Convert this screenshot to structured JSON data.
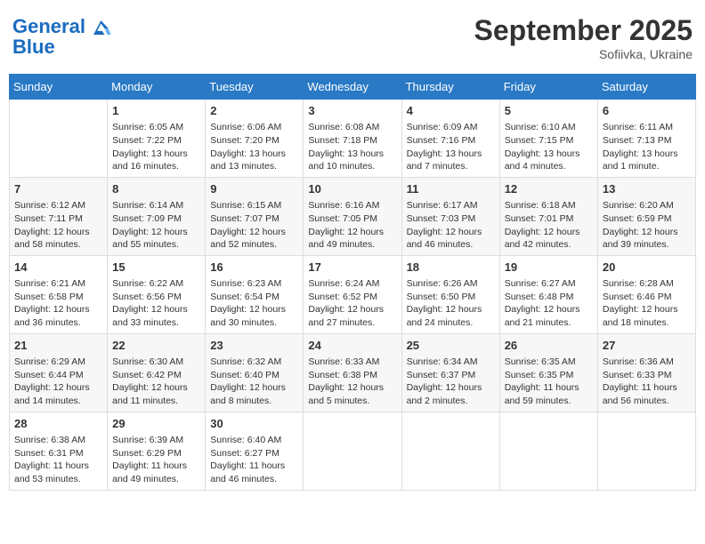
{
  "header": {
    "logo_line1": "General",
    "logo_line2": "Blue",
    "month_title": "September 2025",
    "location": "Sofiivka, Ukraine"
  },
  "weekdays": [
    "Sunday",
    "Monday",
    "Tuesday",
    "Wednesday",
    "Thursday",
    "Friday",
    "Saturday"
  ],
  "weeks": [
    [
      {
        "day": "",
        "sunrise": "",
        "sunset": "",
        "daylight": ""
      },
      {
        "day": "1",
        "sunrise": "Sunrise: 6:05 AM",
        "sunset": "Sunset: 7:22 PM",
        "daylight": "Daylight: 13 hours and 16 minutes."
      },
      {
        "day": "2",
        "sunrise": "Sunrise: 6:06 AM",
        "sunset": "Sunset: 7:20 PM",
        "daylight": "Daylight: 13 hours and 13 minutes."
      },
      {
        "day": "3",
        "sunrise": "Sunrise: 6:08 AM",
        "sunset": "Sunset: 7:18 PM",
        "daylight": "Daylight: 13 hours and 10 minutes."
      },
      {
        "day": "4",
        "sunrise": "Sunrise: 6:09 AM",
        "sunset": "Sunset: 7:16 PM",
        "daylight": "Daylight: 13 hours and 7 minutes."
      },
      {
        "day": "5",
        "sunrise": "Sunrise: 6:10 AM",
        "sunset": "Sunset: 7:15 PM",
        "daylight": "Daylight: 13 hours and 4 minutes."
      },
      {
        "day": "6",
        "sunrise": "Sunrise: 6:11 AM",
        "sunset": "Sunset: 7:13 PM",
        "daylight": "Daylight: 13 hours and 1 minute."
      }
    ],
    [
      {
        "day": "7",
        "sunrise": "Sunrise: 6:12 AM",
        "sunset": "Sunset: 7:11 PM",
        "daylight": "Daylight: 12 hours and 58 minutes."
      },
      {
        "day": "8",
        "sunrise": "Sunrise: 6:14 AM",
        "sunset": "Sunset: 7:09 PM",
        "daylight": "Daylight: 12 hours and 55 minutes."
      },
      {
        "day": "9",
        "sunrise": "Sunrise: 6:15 AM",
        "sunset": "Sunset: 7:07 PM",
        "daylight": "Daylight: 12 hours and 52 minutes."
      },
      {
        "day": "10",
        "sunrise": "Sunrise: 6:16 AM",
        "sunset": "Sunset: 7:05 PM",
        "daylight": "Daylight: 12 hours and 49 minutes."
      },
      {
        "day": "11",
        "sunrise": "Sunrise: 6:17 AM",
        "sunset": "Sunset: 7:03 PM",
        "daylight": "Daylight: 12 hours and 46 minutes."
      },
      {
        "day": "12",
        "sunrise": "Sunrise: 6:18 AM",
        "sunset": "Sunset: 7:01 PM",
        "daylight": "Daylight: 12 hours and 42 minutes."
      },
      {
        "day": "13",
        "sunrise": "Sunrise: 6:20 AM",
        "sunset": "Sunset: 6:59 PM",
        "daylight": "Daylight: 12 hours and 39 minutes."
      }
    ],
    [
      {
        "day": "14",
        "sunrise": "Sunrise: 6:21 AM",
        "sunset": "Sunset: 6:58 PM",
        "daylight": "Daylight: 12 hours and 36 minutes."
      },
      {
        "day": "15",
        "sunrise": "Sunrise: 6:22 AM",
        "sunset": "Sunset: 6:56 PM",
        "daylight": "Daylight: 12 hours and 33 minutes."
      },
      {
        "day": "16",
        "sunrise": "Sunrise: 6:23 AM",
        "sunset": "Sunset: 6:54 PM",
        "daylight": "Daylight: 12 hours and 30 minutes."
      },
      {
        "day": "17",
        "sunrise": "Sunrise: 6:24 AM",
        "sunset": "Sunset: 6:52 PM",
        "daylight": "Daylight: 12 hours and 27 minutes."
      },
      {
        "day": "18",
        "sunrise": "Sunrise: 6:26 AM",
        "sunset": "Sunset: 6:50 PM",
        "daylight": "Daylight: 12 hours and 24 minutes."
      },
      {
        "day": "19",
        "sunrise": "Sunrise: 6:27 AM",
        "sunset": "Sunset: 6:48 PM",
        "daylight": "Daylight: 12 hours and 21 minutes."
      },
      {
        "day": "20",
        "sunrise": "Sunrise: 6:28 AM",
        "sunset": "Sunset: 6:46 PM",
        "daylight": "Daylight: 12 hours and 18 minutes."
      }
    ],
    [
      {
        "day": "21",
        "sunrise": "Sunrise: 6:29 AM",
        "sunset": "Sunset: 6:44 PM",
        "daylight": "Daylight: 12 hours and 14 minutes."
      },
      {
        "day": "22",
        "sunrise": "Sunrise: 6:30 AM",
        "sunset": "Sunset: 6:42 PM",
        "daylight": "Daylight: 12 hours and 11 minutes."
      },
      {
        "day": "23",
        "sunrise": "Sunrise: 6:32 AM",
        "sunset": "Sunset: 6:40 PM",
        "daylight": "Daylight: 12 hours and 8 minutes."
      },
      {
        "day": "24",
        "sunrise": "Sunrise: 6:33 AM",
        "sunset": "Sunset: 6:38 PM",
        "daylight": "Daylight: 12 hours and 5 minutes."
      },
      {
        "day": "25",
        "sunrise": "Sunrise: 6:34 AM",
        "sunset": "Sunset: 6:37 PM",
        "daylight": "Daylight: 12 hours and 2 minutes."
      },
      {
        "day": "26",
        "sunrise": "Sunrise: 6:35 AM",
        "sunset": "Sunset: 6:35 PM",
        "daylight": "Daylight: 11 hours and 59 minutes."
      },
      {
        "day": "27",
        "sunrise": "Sunrise: 6:36 AM",
        "sunset": "Sunset: 6:33 PM",
        "daylight": "Daylight: 11 hours and 56 minutes."
      }
    ],
    [
      {
        "day": "28",
        "sunrise": "Sunrise: 6:38 AM",
        "sunset": "Sunset: 6:31 PM",
        "daylight": "Daylight: 11 hours and 53 minutes."
      },
      {
        "day": "29",
        "sunrise": "Sunrise: 6:39 AM",
        "sunset": "Sunset: 6:29 PM",
        "daylight": "Daylight: 11 hours and 49 minutes."
      },
      {
        "day": "30",
        "sunrise": "Sunrise: 6:40 AM",
        "sunset": "Sunset: 6:27 PM",
        "daylight": "Daylight: 11 hours and 46 minutes."
      },
      {
        "day": "",
        "sunrise": "",
        "sunset": "",
        "daylight": ""
      },
      {
        "day": "",
        "sunrise": "",
        "sunset": "",
        "daylight": ""
      },
      {
        "day": "",
        "sunrise": "",
        "sunset": "",
        "daylight": ""
      },
      {
        "day": "",
        "sunrise": "",
        "sunset": "",
        "daylight": ""
      }
    ]
  ]
}
